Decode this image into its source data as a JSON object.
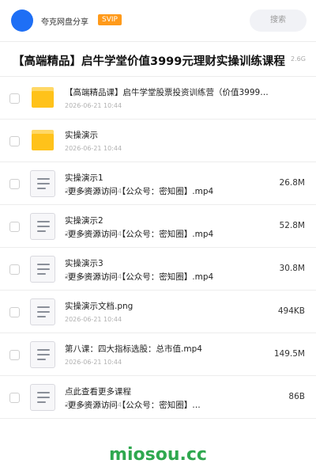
{
  "header": {
    "share_name": "夸克网盘分享",
    "badge": "SVIP",
    "search_label": "搜索"
  },
  "title": {
    "text": "【高端精品】启牛学堂价值3999元理财实操训练课程",
    "size": "2.6G"
  },
  "rows": [
    {
      "type": "folder",
      "name": "【高端精品课】启牛学堂股票投资训练营（价值3999…",
      "date": "2026-06-21 10:44",
      "subname": "",
      "size": ""
    },
    {
      "type": "folder",
      "name": "实操演示",
      "date": "2026-06-21 10:44",
      "subname": "",
      "size": ""
    },
    {
      "type": "file",
      "name": "实操演示1",
      "date": "2026-06-21 10:44",
      "subname": "-更多资源访问【公众号：密知圈】.mp4",
      "size": "26.8M"
    },
    {
      "type": "file",
      "name": "实操演示2",
      "date": "2026-06-21 10:44",
      "subname": "-更多资源访问【公众号：密知圈】.mp4",
      "size": "52.8M"
    },
    {
      "type": "file",
      "name": "实操演示3",
      "date": "2026-06-21 10:44",
      "subname": "-更多资源访问【公众号：密知圈】.mp4",
      "size": "30.8M"
    },
    {
      "type": "file",
      "name": "实操演示文档.png",
      "date": "2026-06-21 10:44",
      "subname": "",
      "size": "494KB"
    },
    {
      "type": "file",
      "name": "第八课：四大指标选股：总市值.mp4",
      "date": "2026-06-21 10:44",
      "subname": "",
      "size": "149.5M"
    },
    {
      "type": "file",
      "name": "点此查看更多课程",
      "date": "2026-06-21 10:44",
      "subname": "-更多资源访问【公众号：密知圈】…",
      "size": "86B"
    }
  ],
  "watermark": "miosou.cc",
  "colors": {
    "accent": "#1e6ff5",
    "svip": "#ff9a1a",
    "folder": "#ffc21a",
    "watermark": "#2fa84f"
  }
}
